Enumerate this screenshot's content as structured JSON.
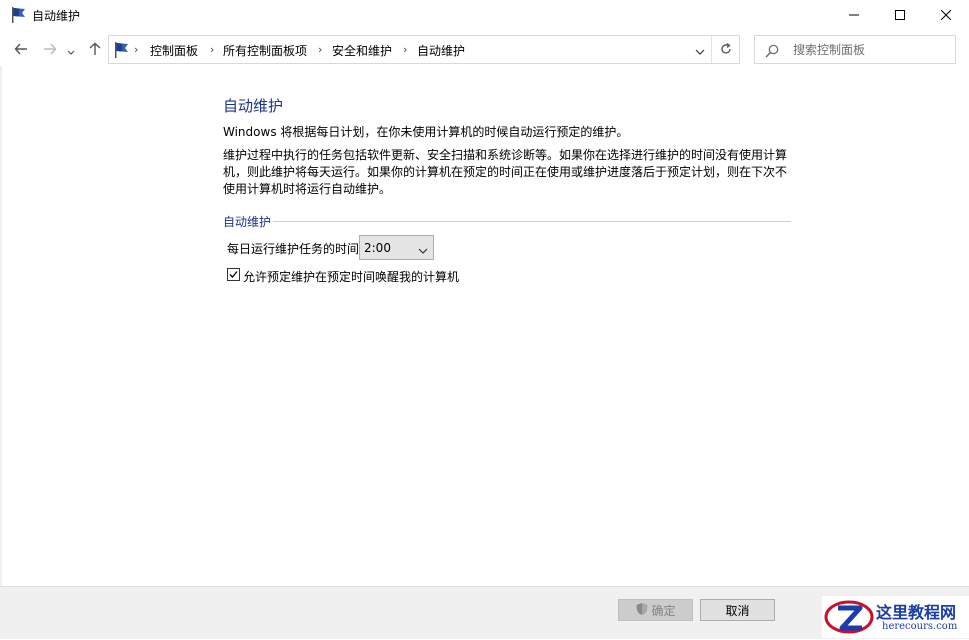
{
  "window": {
    "title": "自动维护",
    "minimize_icon": "minimize-icon",
    "maximize_icon": "maximize-icon",
    "close_icon": "close-icon"
  },
  "nav": {
    "back_icon": "arrow-left-icon",
    "forward_icon": "arrow-right-icon",
    "recent_icon": "chevron-down-icon",
    "up_icon": "arrow-up-icon",
    "breadcrumb": [
      "控制面板",
      "所有控制面板项",
      "安全和维护",
      "自动维护"
    ],
    "search_placeholder": "搜索控制面板"
  },
  "content": {
    "heading": "自动维护",
    "para1": "Windows 将根据每日计划，在你未使用计算机的时候自动运行预定的维护。",
    "para2": "维护过程中执行的任务包括软件更新、安全扫描和系统诊断等。如果你在选择进行维护的时间没有使用计算机，则此维护将每天运行。如果你的计算机在预定的时间正在使用或维护进度落后于预定计划，则在下次不使用计算机时将运行自动维护。",
    "group_label": "自动维护",
    "time_label": "每日运行维护任务的时间",
    "time_value": "2:00",
    "wake_label": "允许预定维护在预定时间唤醒我的计算机",
    "wake_checked": true
  },
  "footer": {
    "ok_label": "确定",
    "cancel_label": "取消"
  },
  "watermark": {
    "line1": "这里教程网",
    "line2": "herecours.com"
  },
  "colors": {
    "heading": "#1e3287",
    "watermark": "#1a3da8",
    "logo_red": "#c8102e"
  }
}
